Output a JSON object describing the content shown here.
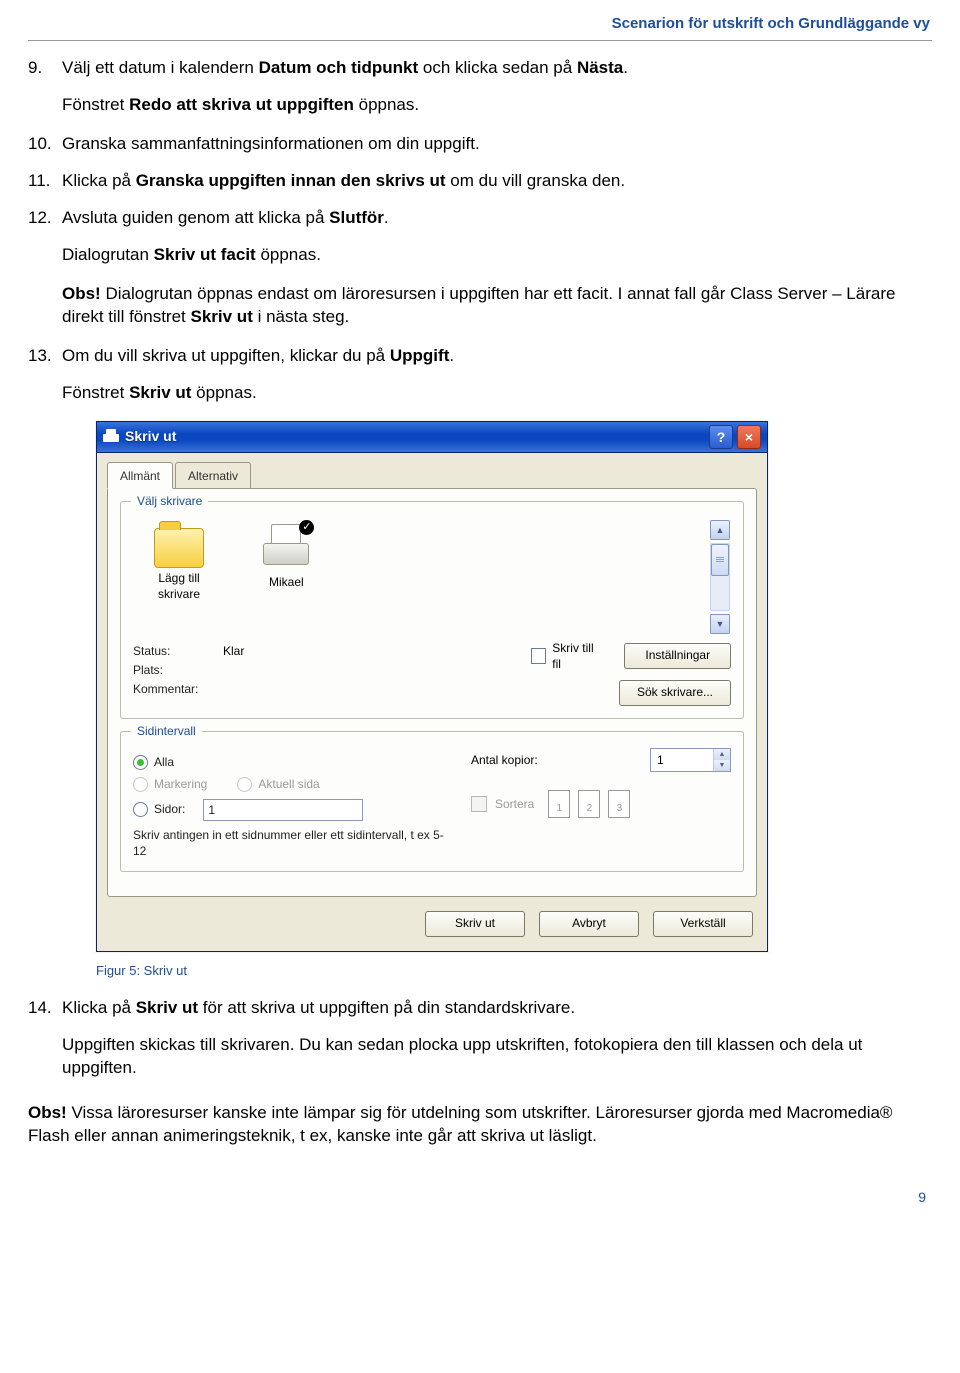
{
  "breadcrumb": "Scenarion för utskrift och Grundläggande vy",
  "steps": {
    "s9_num": "9.",
    "s9a": "Välj ett datum i kalendern ",
    "s9b": "Datum och tidpunkt",
    "s9c": " och klicka sedan på ",
    "s9d": "Nästa",
    "s9e": ".",
    "s9sub_a": "Fönstret ",
    "s9sub_b": "Redo att skriva ut uppgiften",
    "s9sub_c": " öppnas.",
    "s10_num": "10.",
    "s10": "Granska sammanfattningsinformationen om din uppgift.",
    "s11_num": "11.",
    "s11a": "Klicka på ",
    "s11b": "Granska uppgiften innan den skrivs ut",
    "s11c": " om du vill granska den.",
    "s12_num": "12.",
    "s12a": "Avsluta guiden genom att klicka på ",
    "s12b": "Slutför",
    "s12c": ".",
    "s12sub_a": "Dialogrutan ",
    "s12sub_b": "Skriv ut facit",
    "s12sub_c": " öppnas.",
    "s12obs_lead": "Obs!",
    "s12obs_a": " Dialogrutan öppnas endast om läroresursen i uppgiften har ett facit. I annat fall går Class Server – Lärare direkt till fönstret ",
    "s12obs_b": "Skriv ut",
    "s12obs_c": " i nästa steg.",
    "s13_num": "13.",
    "s13a": "Om du vill skriva ut uppgiften, klickar du på ",
    "s13b": "Uppgift",
    "s13c": ".",
    "s13sub_a": "Fönstret ",
    "s13sub_b": "Skriv ut",
    "s13sub_c": " öppnas.",
    "s14_num": "14.",
    "s14a": "Klicka på ",
    "s14b": "Skriv ut",
    "s14c": " för att skriva ut uppgiften på din standardskrivare.",
    "s14sub": "Uppgiften skickas till skrivaren. Du kan sedan plocka upp utskriften, fotokopiera den till klassen och dela ut uppgiften."
  },
  "dialog": {
    "title": "Skriv ut",
    "tabs": {
      "allmant": "Allmänt",
      "alternativ": "Alternativ"
    },
    "group_printer": "Välj skrivare",
    "printers": {
      "add": "Lägg till skrivare",
      "mikael": "Mikael"
    },
    "status_lbl": "Status:",
    "status_val": "Klar",
    "plats_lbl": "Plats:",
    "kommentar_lbl": "Kommentar:",
    "skriv_till_fil": "Skriv till fil",
    "installningar": "Inställningar",
    "sok_skrivare": "Sök skrivare...",
    "group_interval": "Sidintervall",
    "alla": "Alla",
    "markering": "Markering",
    "aktuell": "Aktuell sida",
    "sidor": "Sidor:",
    "sidor_val": "1",
    "hint": "Skriv antingen in ett sidnummer eller ett sidintervall, t ex 5-12",
    "antal_kopior": "Antal kopior:",
    "antal_val": "1",
    "sortera": "Sortera",
    "p1": "1",
    "p2": "2",
    "p3": "3",
    "btn_skriv": "Skriv ut",
    "btn_avbryt": "Avbryt",
    "btn_verkstall": "Verkställ"
  },
  "caption": "Figur 5: Skriv ut",
  "footer": {
    "obs_lead": "Obs!",
    "obs_text": " Vissa läroresurser kanske inte lämpar sig för utdelning som utskrifter. Läroresurser gjorda med Macromedia® Flash eller annan animeringsteknik, t ex, kanske inte går att skriva ut läsligt."
  },
  "pagenum": "9"
}
